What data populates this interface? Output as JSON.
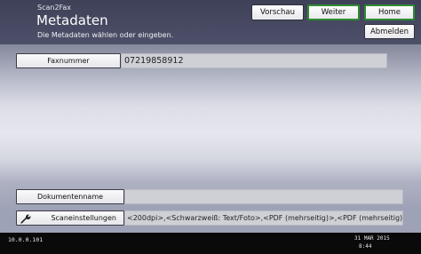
{
  "header": {
    "app_name": "Scan2Fax",
    "title": "Metadaten",
    "subtitle": "Die Metadaten wählen oder eingeben.",
    "buttons": {
      "preview": "Vorschau",
      "next": "Weiter",
      "home": "Home",
      "logout": "Abmelden"
    }
  },
  "fields": {
    "fax": {
      "label": "Faxnummer",
      "value": "07219858912"
    },
    "document": {
      "label": "Dokumentenname",
      "value": ""
    },
    "scan": {
      "label": "Scaneinstellungen",
      "value": "<200dpi>,<Schwarzweiß: Text/Foto>,<PDF (mehrseitig)>,<PDF (mehrseitig)>",
      "icon": "wrench-icon"
    }
  },
  "status": {
    "ip": "10.0.0.101",
    "date": "31 MAR  2015",
    "time": "8:44"
  },
  "colors": {
    "header_bg": "#3e4157",
    "accent_green": "#2f8a33",
    "status_bg": "#0a0a0a"
  }
}
